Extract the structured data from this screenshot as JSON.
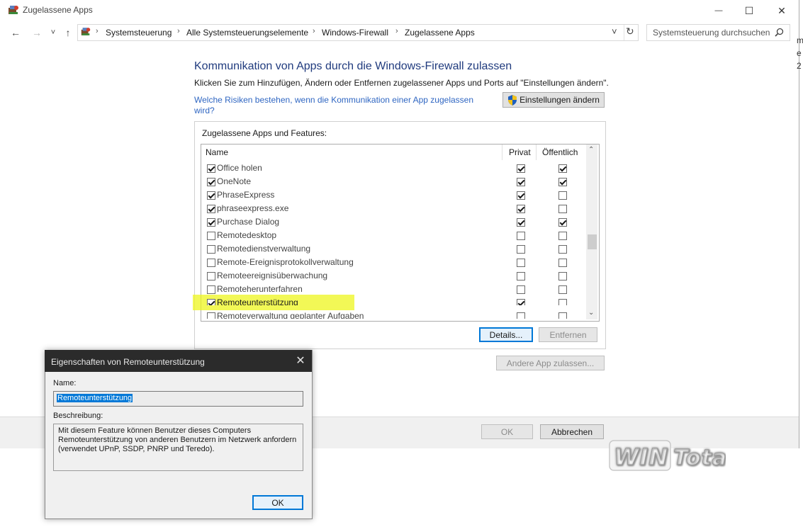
{
  "window": {
    "title": "Zugelassene Apps",
    "minimize_glyph": "—",
    "maximize_glyph": "☐",
    "close_glyph": "✕"
  },
  "navigation": {
    "back_glyph": "←",
    "forward_glyph": "→",
    "recent_glyph": "˅",
    "up_glyph": "↑",
    "breadcrumb": [
      "Systemsteuerung",
      "Alle Systemsteuerungselemente",
      "Windows-Firewall",
      "Zugelassene Apps"
    ],
    "refresh_glyph": "↻",
    "dropdown_glyph": "˅",
    "search_placeholder": "Systemsteuerung durchsuchen",
    "search_icon": "search-icon"
  },
  "main": {
    "heading": "Kommunikation von Apps durch die Windows-Firewall zulassen",
    "intro": "Klicken Sie zum Hinzufügen, Ändern oder Entfernen zugelassener Apps und Ports auf \"Einstellungen ändern\".",
    "risk_link": "Welche Risiken bestehen, wenn die Kommunikation einer App zugelassen wird?",
    "settings_button": "Einstellungen ändern",
    "group_label": "Zugelassene Apps und Features:",
    "columns": {
      "name": "Name",
      "private": "Privat",
      "public": "Öffentlich"
    },
    "apps": [
      {
        "name": "Office holen",
        "enabled": true,
        "private": true,
        "public": true
      },
      {
        "name": "OneNote",
        "enabled": true,
        "private": true,
        "public": true
      },
      {
        "name": "PhraseExpress",
        "enabled": true,
        "private": true,
        "public": false
      },
      {
        "name": "phraseexpress.exe",
        "enabled": true,
        "private": true,
        "public": false
      },
      {
        "name": "Purchase Dialog",
        "enabled": true,
        "private": true,
        "public": true
      },
      {
        "name": "Remotedesktop",
        "enabled": false,
        "private": false,
        "public": false
      },
      {
        "name": "Remotedienstverwaltung",
        "enabled": false,
        "private": false,
        "public": false
      },
      {
        "name": "Remote-Ereignisprotokollverwaltung",
        "enabled": false,
        "private": false,
        "public": false
      },
      {
        "name": "Remoteereignisüberwachung",
        "enabled": false,
        "private": false,
        "public": false
      },
      {
        "name": "Remoteherunterfahren",
        "enabled": false,
        "private": false,
        "public": false
      },
      {
        "name": "Remoteunterstützung",
        "enabled": true,
        "private": true,
        "public": false,
        "selected": true
      },
      {
        "name": "Remoteverwaltung geplanter Aufgaben",
        "enabled": false,
        "private": false,
        "public": false
      }
    ],
    "details_button": "Details...",
    "remove_button": "Entfernen",
    "other_app_button": "Andere App zulassen...",
    "ok_button": "OK",
    "cancel_button": "Abbrechen"
  },
  "edge_text": [
    "m",
    "e",
    "2"
  ],
  "dialog": {
    "title": "Eigenschaften von Remoteunterstützung",
    "close_glyph": "✕",
    "name_label": "Name:",
    "name_value": "Remoteunterstützung",
    "description_label": "Beschreibung:",
    "description": "Mit diesem Feature können Benutzer dieses Computers Remoteunterstützung von anderen Benutzern im Netzwerk anfordern (verwendet UPnP, SSDP, PNRP und Teredo).",
    "ok_button": "OK"
  },
  "watermark": {
    "text": "WinTotal"
  },
  "colors": {
    "heading": "#203b7e",
    "link": "#2f66c2",
    "highlight": "#eef51e",
    "dialog_titlebar": "#2b2b2b",
    "selection": "#0078d7"
  }
}
